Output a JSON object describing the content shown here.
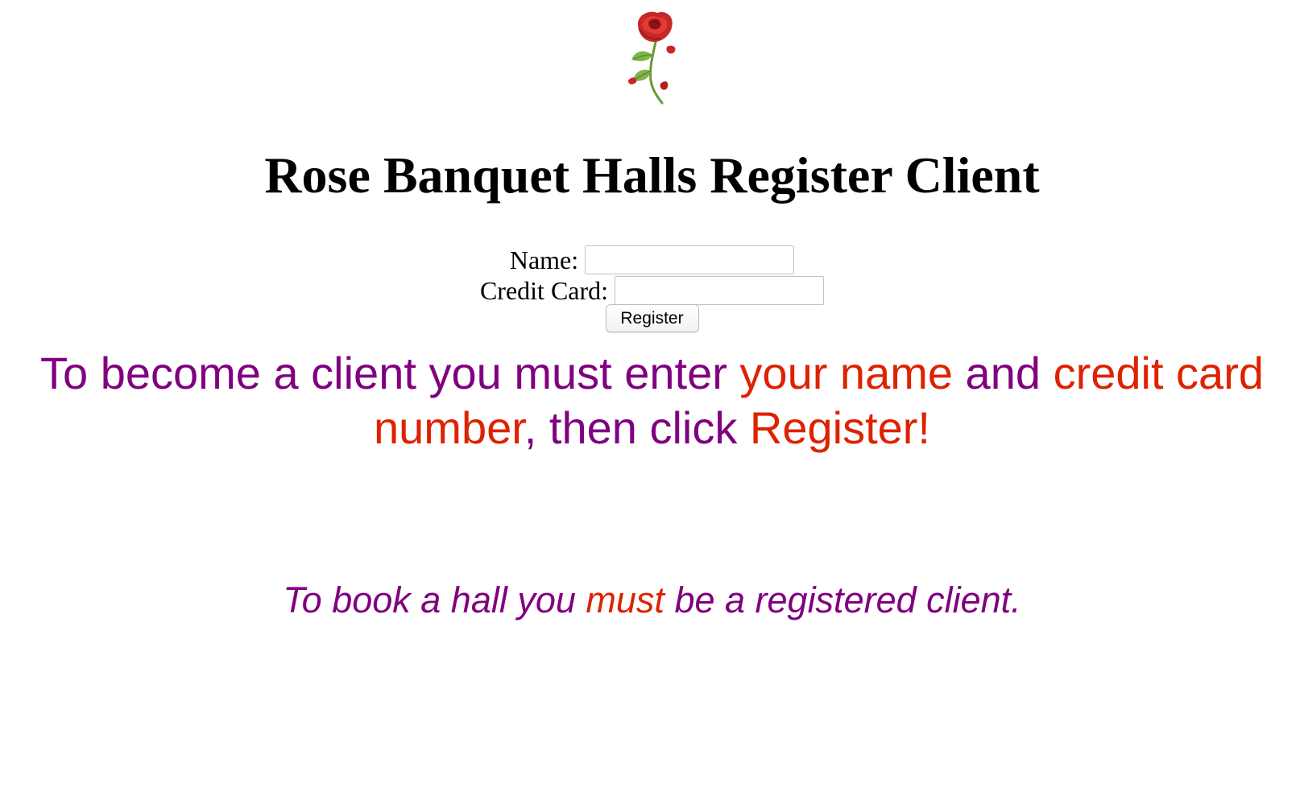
{
  "header": {
    "logo_icon": "rose-icon",
    "title": "Rose Banquet Halls Register Client"
  },
  "form": {
    "name_label": "Name:",
    "name_value": "",
    "card_label": "Credit Card:",
    "card_value": "",
    "register_label": "Register"
  },
  "instructions": {
    "part1": "To become a client you must enter ",
    "part2": "your name",
    "part3": " and ",
    "part4": "credit card number",
    "part5": ", then click ",
    "part6": "Register!"
  },
  "note": {
    "part1": "To book a hall you ",
    "part2": "must",
    "part3": " be a registered client."
  },
  "colors": {
    "purple": "#800080",
    "red": "#dd2200"
  }
}
